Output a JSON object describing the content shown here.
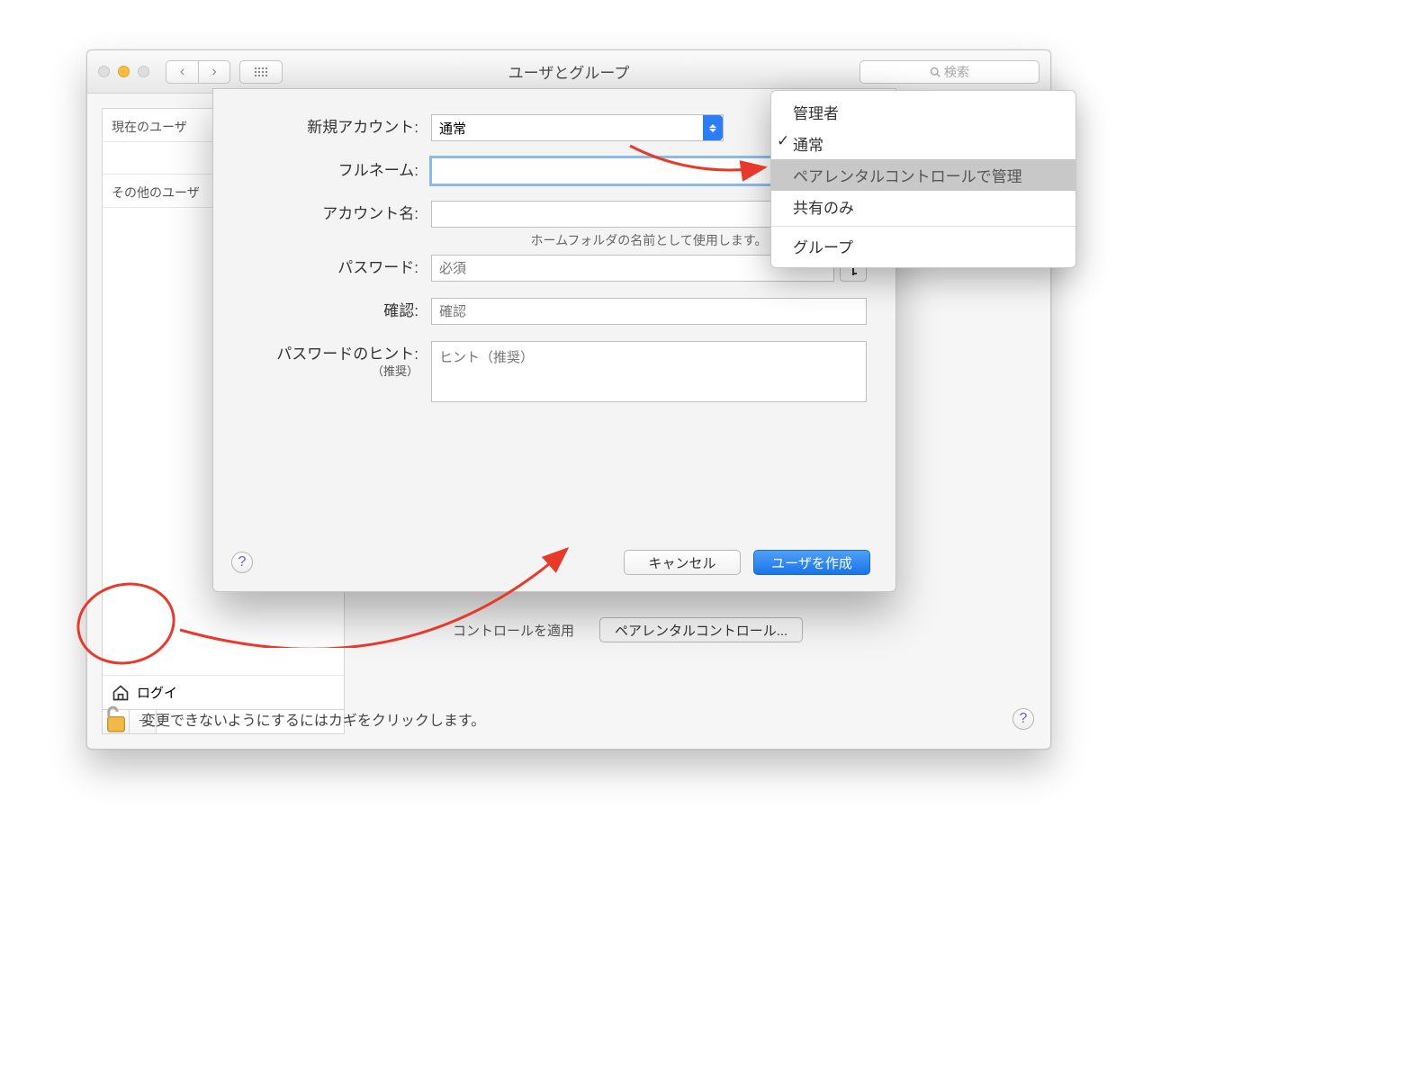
{
  "window": {
    "title": "ユーザとグループ"
  },
  "search": {
    "placeholder": "検索"
  },
  "sidebar": {
    "current_header": "現在のユーザ",
    "other_header": "その他のユーザ",
    "login_options": "ログイ"
  },
  "below": {
    "apply_control": "コントロールを適用",
    "parental": "ペアレンタルコントロール..."
  },
  "footer": {
    "lock_text": "変更できないようにするにはカギをクリックします。"
  },
  "sheet": {
    "new_account_label": "新規アカウント:",
    "new_account_value": "通常",
    "fullname_label": "フルネーム:",
    "accountname_label": "アカウント名:",
    "accountname_hint": "ホームフォルダの名前として使用します。",
    "password_label": "パスワード:",
    "password_placeholder": "必須",
    "verify_label": "確認:",
    "verify_placeholder": "確認",
    "hint_label": "パスワードのヒント:",
    "hint_sub": "（推奨）",
    "hint_placeholder": "ヒント（推奨）",
    "cancel": "キャンセル",
    "create": "ユーザを作成"
  },
  "dropdown": {
    "items": [
      {
        "label": "管理者",
        "checked": false
      },
      {
        "label": "通常",
        "checked": true
      },
      {
        "label": "ペアレンタルコントロールで管理",
        "checked": false,
        "highlighted": true
      },
      {
        "label": "共有のみ",
        "checked": false
      }
    ],
    "group_label": "グループ"
  }
}
